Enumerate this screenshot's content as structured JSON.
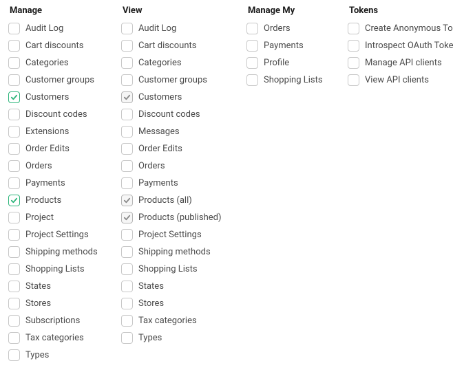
{
  "columns": [
    {
      "heading": "Manage",
      "items": [
        {
          "label": "Audit Log",
          "checked": false,
          "style": "green"
        },
        {
          "label": "Cart discounts",
          "checked": false,
          "style": "green"
        },
        {
          "label": "Categories",
          "checked": false,
          "style": "green"
        },
        {
          "label": "Customer groups",
          "checked": false,
          "style": "green"
        },
        {
          "label": "Customers",
          "checked": true,
          "style": "green"
        },
        {
          "label": "Discount codes",
          "checked": false,
          "style": "green"
        },
        {
          "label": "Extensions",
          "checked": false,
          "style": "green"
        },
        {
          "label": "Order Edits",
          "checked": false,
          "style": "green"
        },
        {
          "label": "Orders",
          "checked": false,
          "style": "green"
        },
        {
          "label": "Payments",
          "checked": false,
          "style": "green"
        },
        {
          "label": "Products",
          "checked": true,
          "style": "green"
        },
        {
          "label": "Project",
          "checked": false,
          "style": "green"
        },
        {
          "label": "Project Settings",
          "checked": false,
          "style": "green"
        },
        {
          "label": "Shipping methods",
          "checked": false,
          "style": "green"
        },
        {
          "label": "Shopping Lists",
          "checked": false,
          "style": "green"
        },
        {
          "label": "States",
          "checked": false,
          "style": "green"
        },
        {
          "label": "Stores",
          "checked": false,
          "style": "green"
        },
        {
          "label": "Subscriptions",
          "checked": false,
          "style": "green"
        },
        {
          "label": "Tax categories",
          "checked": false,
          "style": "green"
        },
        {
          "label": "Types",
          "checked": false,
          "style": "green"
        }
      ]
    },
    {
      "heading": "View",
      "items": [
        {
          "label": "Audit Log",
          "checked": false,
          "style": "gray"
        },
        {
          "label": "Cart discounts",
          "checked": false,
          "style": "gray"
        },
        {
          "label": "Categories",
          "checked": false,
          "style": "gray"
        },
        {
          "label": "Customer groups",
          "checked": false,
          "style": "gray"
        },
        {
          "label": "Customers",
          "checked": true,
          "style": "gray"
        },
        {
          "label": "Discount codes",
          "checked": false,
          "style": "gray"
        },
        {
          "label": "Messages",
          "checked": false,
          "style": "gray"
        },
        {
          "label": "Order Edits",
          "checked": false,
          "style": "gray"
        },
        {
          "label": "Orders",
          "checked": false,
          "style": "gray"
        },
        {
          "label": "Payments",
          "checked": false,
          "style": "gray"
        },
        {
          "label": "Products (all)",
          "checked": true,
          "style": "gray"
        },
        {
          "label": "Products (published)",
          "checked": true,
          "style": "gray"
        },
        {
          "label": "Project Settings",
          "checked": false,
          "style": "gray"
        },
        {
          "label": "Shipping methods",
          "checked": false,
          "style": "gray"
        },
        {
          "label": "Shopping Lists",
          "checked": false,
          "style": "gray"
        },
        {
          "label": "States",
          "checked": false,
          "style": "gray"
        },
        {
          "label": "Stores",
          "checked": false,
          "style": "gray"
        },
        {
          "label": "Tax categories",
          "checked": false,
          "style": "gray"
        },
        {
          "label": "Types",
          "checked": false,
          "style": "gray"
        }
      ]
    },
    {
      "heading": "Manage My",
      "items": [
        {
          "label": "Orders",
          "checked": false,
          "style": "green"
        },
        {
          "label": "Payments",
          "checked": false,
          "style": "green"
        },
        {
          "label": "Profile",
          "checked": false,
          "style": "green"
        },
        {
          "label": "Shopping Lists",
          "checked": false,
          "style": "green"
        }
      ]
    },
    {
      "heading": "Tokens",
      "items": [
        {
          "label": "Create Anonymous Token",
          "checked": false,
          "style": "green"
        },
        {
          "label": "Introspect OAuth Tokens",
          "checked": false,
          "style": "green"
        },
        {
          "label": "Manage API clients",
          "checked": false,
          "style": "green"
        },
        {
          "label": "View API clients",
          "checked": false,
          "style": "green"
        }
      ]
    }
  ]
}
